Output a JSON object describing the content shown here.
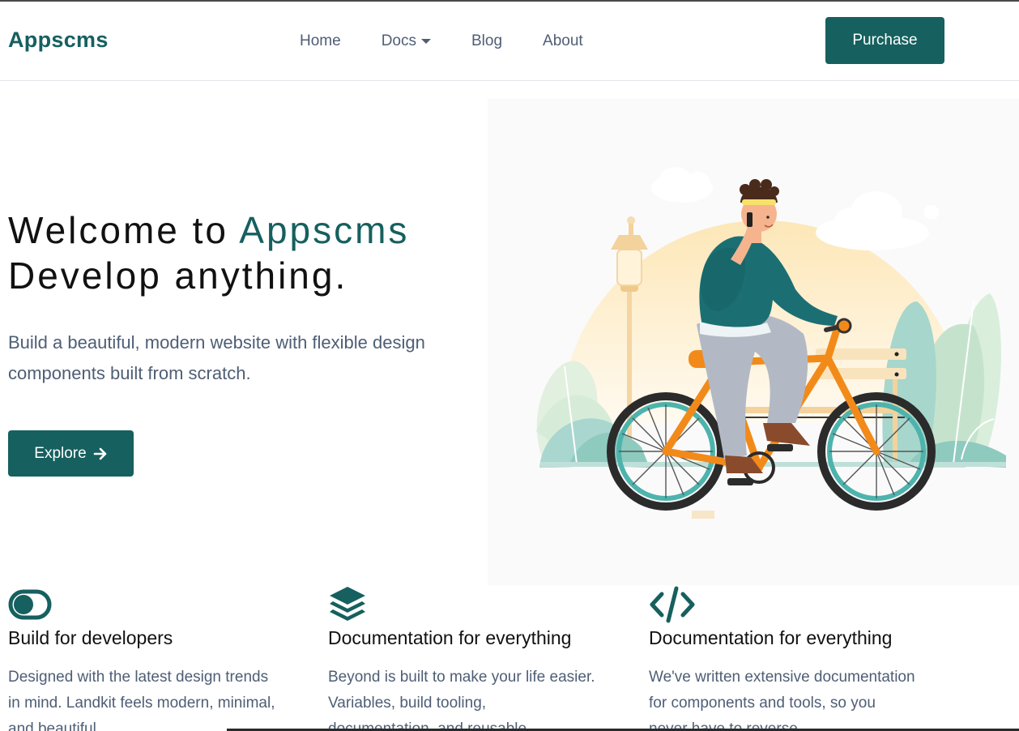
{
  "brand": {
    "name": "Appscms"
  },
  "nav": {
    "items": [
      {
        "label": "Home"
      },
      {
        "label": "Docs"
      },
      {
        "label": "Blog"
      },
      {
        "label": "About"
      }
    ],
    "purchase_label": "Purchase"
  },
  "hero": {
    "title_prefix": "Welcome to ",
    "title_accent": "Appscms",
    "title_line2": "Develop anything.",
    "subtitle": "Build a beautiful, modern website with flexible design components built from scratch.",
    "cta_label": "Explore",
    "illustration_icon": "person-on-bicycle-illustration"
  },
  "features": [
    {
      "icon": "toggle-icon",
      "title": "Build for developers",
      "text": "Designed with the latest design trends in mind. Landkit feels modern, minimal, and beautiful."
    },
    {
      "icon": "layers-icon",
      "title": "Documentation for everything",
      "text": "Beyond is built to make your life easier. Variables, build tooling, documentation, and reusable"
    },
    {
      "icon": "code-icon",
      "title": "Documentation for everything",
      "text": "We've written extensive documentation for components and tools, so you never have to reverse"
    }
  ],
  "colors": {
    "brand": "#16605f",
    "muted_text": "#4e5e75",
    "bike_orange": "#f28a1a",
    "shirt_teal": "#1b6f73"
  }
}
